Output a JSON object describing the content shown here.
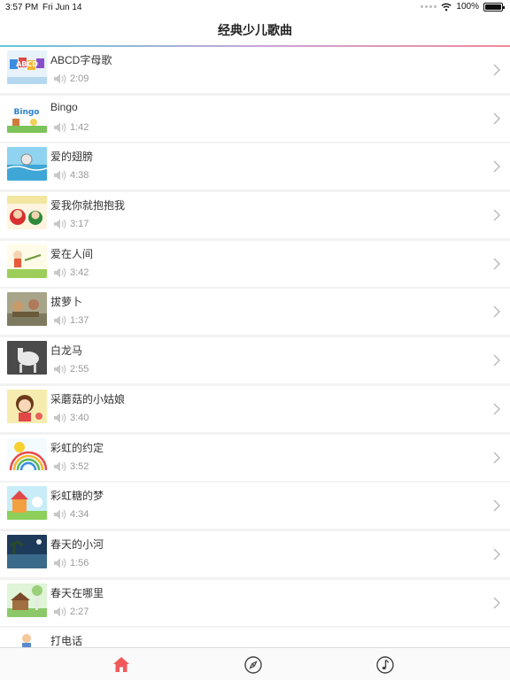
{
  "status_bar": {
    "time": "3:57 PM",
    "date": "Fri Jun 14",
    "battery": "100%"
  },
  "nav": {
    "title": "经典少儿歌曲"
  },
  "songs": [
    {
      "title": "ABCD字母歌",
      "duration": "2:09"
    },
    {
      "title": "Bingo",
      "duration": "1:42"
    },
    {
      "title": "爱的翅膀",
      "duration": "4:38"
    },
    {
      "title": "爱我你就抱抱我",
      "duration": "3:17"
    },
    {
      "title": "爱在人间",
      "duration": "3:42"
    },
    {
      "title": "拔萝卜",
      "duration": "1:37"
    },
    {
      "title": "白龙马",
      "duration": "2:55"
    },
    {
      "title": "采蘑菇的小姑娘",
      "duration": "3:40"
    },
    {
      "title": "彩虹的约定",
      "duration": "3:52"
    },
    {
      "title": "彩虹糖的梦",
      "duration": "4:34"
    },
    {
      "title": "春天的小河",
      "duration": "1:56"
    },
    {
      "title": "春天在哪里",
      "duration": "2:27"
    },
    {
      "title": "打电话",
      "duration": ""
    }
  ],
  "thumb_text": {
    "abcd": "ABCD",
    "bingo": "Bingo"
  },
  "tabs": [
    {
      "icon": "home-icon",
      "active": true
    },
    {
      "icon": "compass-icon",
      "active": false
    },
    {
      "icon": "music-note-icon",
      "active": false
    }
  ],
  "colors": {
    "accent": "#f05a5a",
    "inactive": "#555555",
    "gradient": [
      "#5fc8d8",
      "#f08a9a"
    ]
  }
}
